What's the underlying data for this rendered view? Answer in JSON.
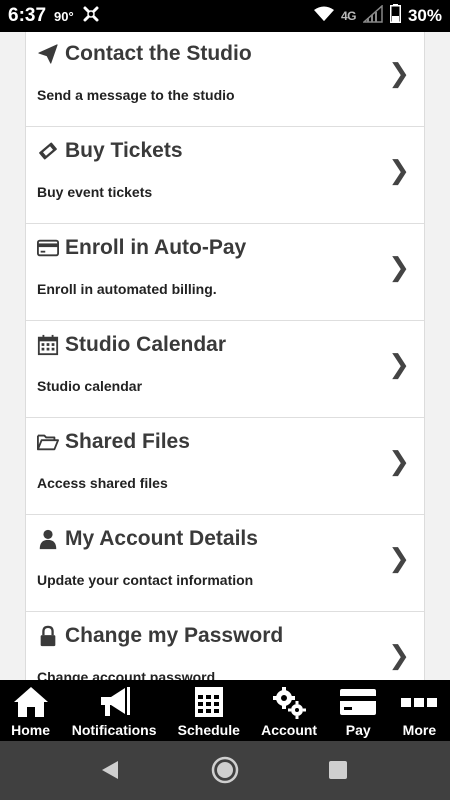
{
  "status_bar": {
    "time": "6:37",
    "temperature": "90°",
    "network": "4G",
    "battery": "30%"
  },
  "menu": {
    "items": [
      {
        "icon": "paper-plane-icon",
        "title": "Contact the Studio",
        "description": "Send a message to the studio"
      },
      {
        "icon": "ticket-icon",
        "title": "Buy Tickets",
        "description": "Buy event tickets"
      },
      {
        "icon": "credit-card-icon",
        "title": "Enroll in Auto-Pay",
        "description": "Enroll in automated billing."
      },
      {
        "icon": "calendar-icon",
        "title": "Studio Calendar",
        "description": "Studio calendar"
      },
      {
        "icon": "folder-open-icon",
        "title": "Shared Files",
        "description": "Access shared files"
      },
      {
        "icon": "user-icon",
        "title": "My Account Details",
        "description": "Update your contact information"
      },
      {
        "icon": "lock-icon",
        "title": "Change my Password",
        "description": "Change account password"
      }
    ],
    "chevron": "❯"
  },
  "tab_bar": {
    "tabs": [
      {
        "icon": "home-icon",
        "label": "Home"
      },
      {
        "icon": "megaphone-icon",
        "label": "Notifications"
      },
      {
        "icon": "calendar-grid-icon",
        "label": "Schedule"
      },
      {
        "icon": "gears-icon",
        "label": "Account"
      },
      {
        "icon": "credit-card-icon",
        "label": "Pay"
      },
      {
        "icon": "more-dots-icon",
        "label": "More"
      }
    ]
  },
  "colors": {
    "status_bar_bg": "#000000",
    "tab_bar_bg": "#000000",
    "system_nav_bg": "#404040",
    "page_bg": "#f2f2f2",
    "card_bg": "#ffffff",
    "title_text": "#3a3a3a"
  }
}
